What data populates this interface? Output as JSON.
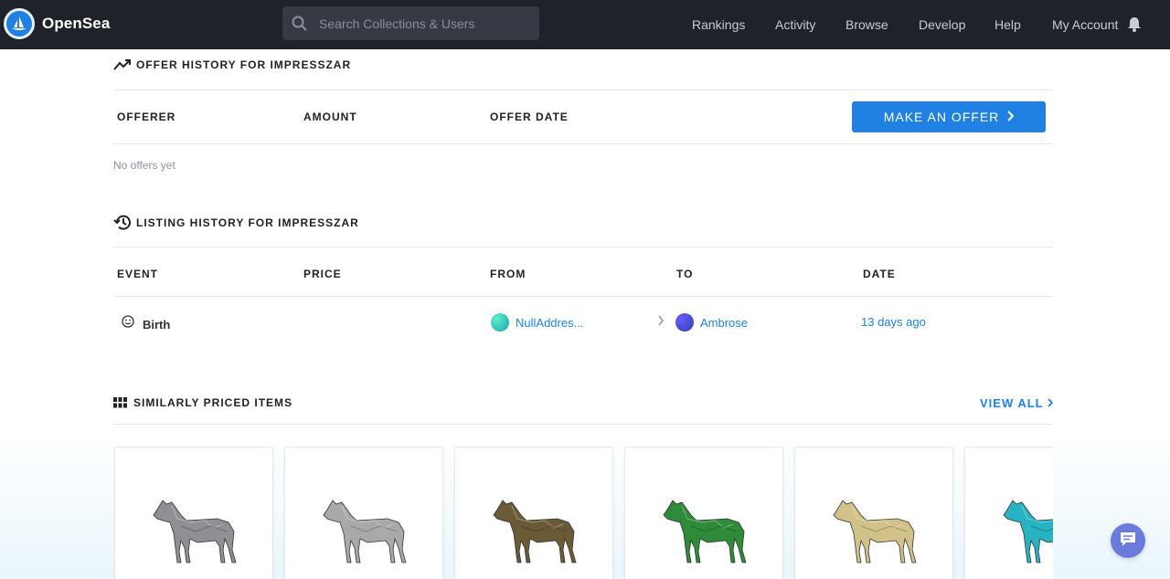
{
  "nav": {
    "brand": "OpenSea",
    "search_placeholder": "Search Collections & Users",
    "links": [
      "Rankings",
      "Activity",
      "Browse",
      "Develop",
      "Help",
      "My Account"
    ]
  },
  "offers": {
    "title": "OFFER HISTORY FOR IMPRESSZAR",
    "columns": [
      "OFFERER",
      "AMOUNT",
      "OFFER DATE"
    ],
    "button_label": "MAKE AN OFFER",
    "empty": "No offers yet"
  },
  "listing": {
    "title": "LISTING HISTORY FOR IMPRESSZAR",
    "columns": [
      "EVENT",
      "PRICE",
      "FROM",
      "TO",
      "DATE"
    ],
    "rows": [
      {
        "event": "Birth",
        "price": "",
        "from": "NullAddres...",
        "to": "Ambrose",
        "date": "13 days ago"
      }
    ]
  },
  "similar": {
    "title": "SIMILARLY PRICED ITEMS",
    "view_all": "VIEW ALL",
    "items": [
      {
        "icon": "horse-gray-icon",
        "color": "#8f8f94"
      },
      {
        "icon": "horse-silver-icon",
        "color": "#a9a9a9"
      },
      {
        "icon": "horse-brown-icon",
        "color": "#6b5a36"
      },
      {
        "icon": "horse-green-icon",
        "color": "#2e8b3a"
      },
      {
        "icon": "horse-cream-icon",
        "color": "#d2c28a"
      },
      {
        "icon": "horse-teal-icon",
        "color": "#27b3c2"
      }
    ]
  },
  "colors": {
    "accent": "#2081e2",
    "navbar": "#1f2229",
    "chat": "#6a7bdc"
  }
}
